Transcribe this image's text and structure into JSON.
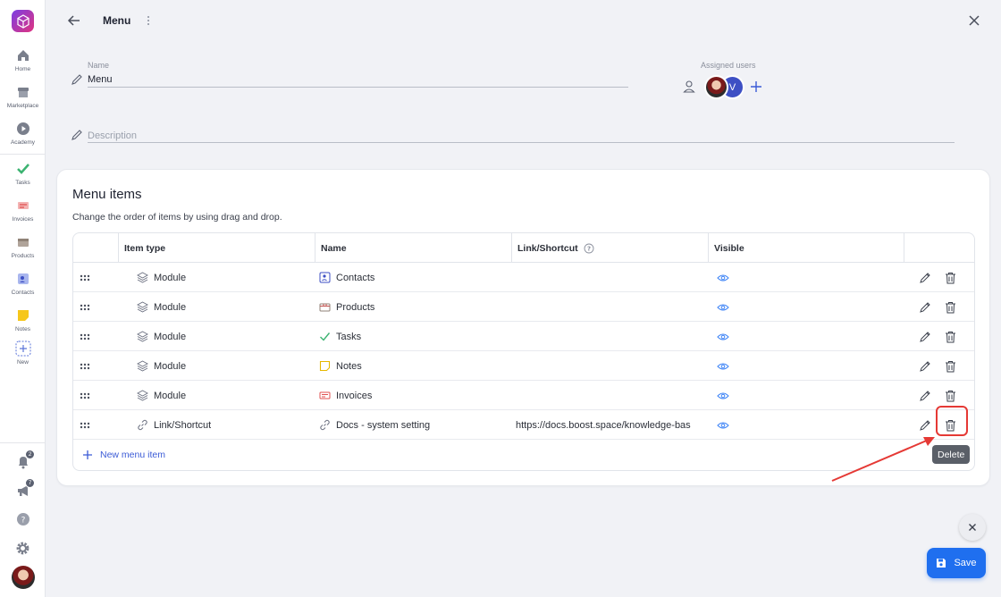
{
  "sidebar": {
    "items": [
      {
        "label": "Home",
        "icon": "home-icon"
      },
      {
        "label": "Marketplace",
        "icon": "store-icon"
      },
      {
        "label": "Academy",
        "icon": "play-icon"
      },
      {
        "label": "Tasks",
        "icon": "check-icon"
      },
      {
        "label": "Invoices",
        "icon": "invoice-icon"
      },
      {
        "label": "Products",
        "icon": "box-icon"
      },
      {
        "label": "Contacts",
        "icon": "contacts-icon"
      },
      {
        "label": "Notes",
        "icon": "note-icon"
      },
      {
        "label": "New",
        "icon": "plus-icon"
      }
    ],
    "notifications_count": "2",
    "announcements_count": "7"
  },
  "header": {
    "title": "Menu"
  },
  "form": {
    "name_label": "Name",
    "name_value": "Menu",
    "description_placeholder": "Description",
    "assigned_users_label": "Assigned users",
    "second_user_initial": "V"
  },
  "menu_items": {
    "title": "Menu items",
    "subtitle": "Change the order of items by using drag and drop.",
    "columns": {
      "item_type": "Item type",
      "name": "Name",
      "link": "Link/Shortcut",
      "visible": "Visible"
    },
    "rows": [
      {
        "type": "Module",
        "name": "Contacts",
        "link": ""
      },
      {
        "type": "Module",
        "name": "Products",
        "link": ""
      },
      {
        "type": "Module",
        "name": "Tasks",
        "link": ""
      },
      {
        "type": "Module",
        "name": "Notes",
        "link": ""
      },
      {
        "type": "Module",
        "name": "Invoices",
        "link": ""
      },
      {
        "type": "Link/Shortcut",
        "name": "Docs - system setting",
        "link": "https://docs.boost.space/knowledge-bas"
      }
    ],
    "new_item_label": "New menu item"
  },
  "tooltip": "Delete",
  "save_label": "Save",
  "colors": {
    "accent": "#1f6fef",
    "highlight": "#e53935"
  }
}
